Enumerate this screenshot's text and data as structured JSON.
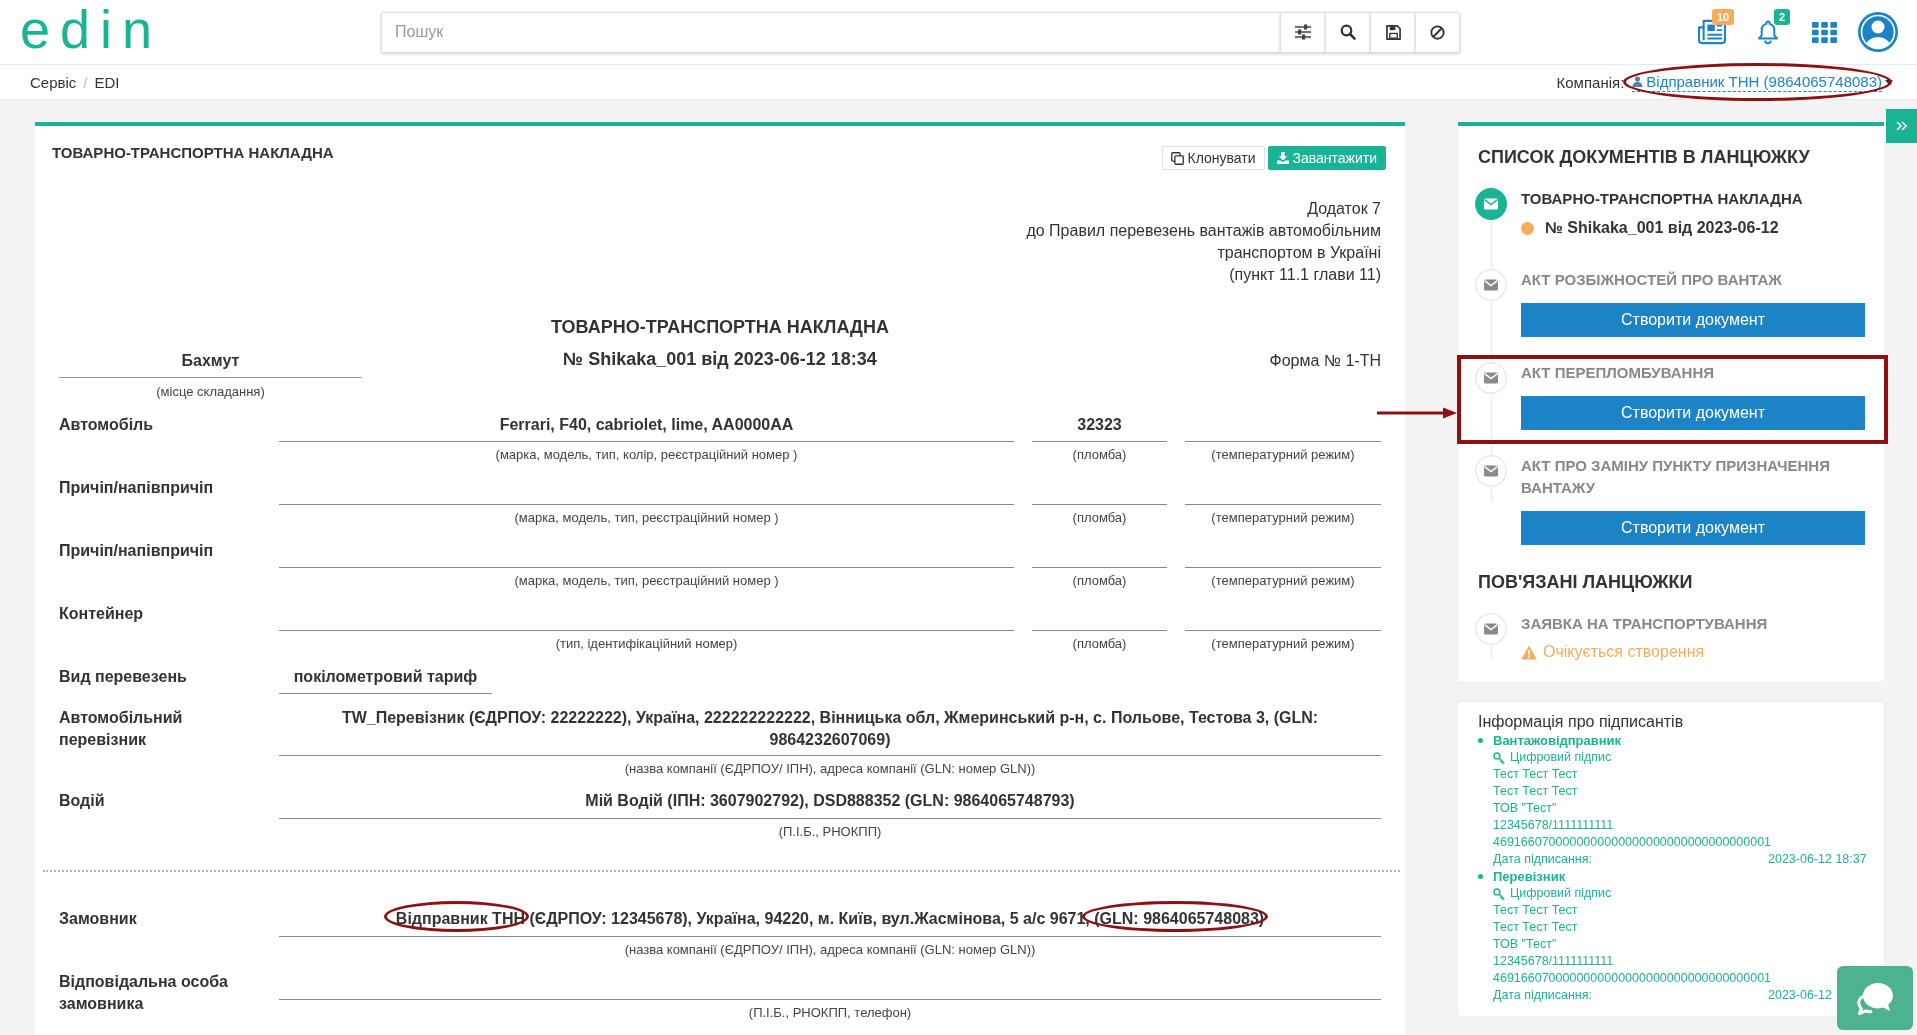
{
  "header": {
    "logo": "edin",
    "search": {
      "placeholder": "Пошук"
    },
    "notifications": [
      {
        "kind": "news",
        "badge": "10",
        "color": "#f8ac59"
      },
      {
        "kind": "bell",
        "badge": "2",
        "color": "#1ab394"
      }
    ]
  },
  "breadcrumbs": {
    "separator": "/",
    "items": [
      {
        "label": "Сервіс"
      },
      {
        "label": "EDI"
      }
    ]
  },
  "company": {
    "label": "Компанія:",
    "value": "Відправник ТНН (9864065748083)",
    "circled": true
  },
  "document": {
    "title": "ТОВАРНО-ТРАНСПОРТНА НАКЛАДНА",
    "actions": [
      {
        "kind": "clone",
        "label": "Клонувати"
      },
      {
        "kind": "download",
        "label": "Завантажити"
      }
    ],
    "appendix_note": [
      "Додаток 7",
      "до Правил перевезень вантажів автомобільним",
      "транспортом в Україні",
      "(пункт 11.1 глави 11)"
    ],
    "heading": [
      "ТОВАРНО-ТРАНСПОРТНА НАКЛАДНА",
      "№ Shikaka_001 від 2023-06-12 18:34"
    ],
    "place": {
      "value": "Бахмут",
      "caption": "(місце складання)"
    },
    "form_number": "Форма № 1-ТН",
    "sections": [
      {
        "rows": [
          {
            "kind": "triple",
            "label": "Автомобіль",
            "fields": [
              {
                "value": "Ferrari, F40, cabriolet, lime, AA0000AA",
                "caption": "(марка, модель, тип, колір, реєстраційний номер )"
              },
              {
                "value": "32323",
                "caption": "(пломба)"
              },
              {
                "caption": "(температурний режим)"
              }
            ]
          },
          {
            "kind": "triple",
            "label": "Причіп/напівпричіп",
            "fields": [
              {
                "caption": "(марка, модель, тип, реєстраційний номер )"
              },
              {
                "caption": "(пломба)"
              },
              {
                "caption": "(температурний режим)"
              }
            ]
          },
          {
            "kind": "triple",
            "label": "Причіп/напівпричіп",
            "fields": [
              {
                "caption": "(марка, модель, тип, реєстраційний номер )"
              },
              {
                "caption": "(пломба)"
              },
              {
                "caption": "(температурний режим)"
              }
            ]
          },
          {
            "kind": "triple",
            "label": "Контейнер",
            "fields": [
              {
                "caption": "(тип, ідентифікаційний номер)"
              },
              {
                "caption": "(пломба)"
              },
              {
                "caption": "(температурний режим)"
              }
            ]
          },
          {
            "kind": "short",
            "label": "Вид перевезень",
            "fields": [
              {
                "value": "покілометровий тариф"
              }
            ]
          },
          {
            "kind": "wide",
            "label": "Автомобільний перевізник",
            "fields": [
              {
                "value": "TW_Перевізник (ЄДРПОУ: 22222222), Україна, 222222222222, Вінницька обл, Жмеринський р-н, с. Польове, Тестова 3, (GLN: 9864232607069)",
                "caption": "(назва компанії (ЄДРПОУ/ ІПН), адреса компанії (GLN: номер GLN))"
              }
            ]
          },
          {
            "kind": "wide",
            "label": "Водій",
            "fields": [
              {
                "value": "Мій Водій (ІПН: 3607902792), DSD888352 (GLN: 9864065748793)",
                "caption": "(П.І.Б., РНОКПП)"
              }
            ]
          }
        ]
      },
      {
        "rows": [
          {
            "kind": "wide",
            "label": "Замовник",
            "fields": [
              {
                "value_parts": [
                  {
                    "text": "Відправник ТНН",
                    "circled": true
                  },
                  {
                    "text": " (ЄДРПОУ: 12345678), Україна, 94220, м. Київ, вул.Жасмінова, 5 а/с 9671, ",
                    "circled": false
                  },
                  {
                    "text": "(GLN: 9864065748083)",
                    "circled": true
                  }
                ],
                "caption": "(назва компанії (ЄДРПОУ/ ІПН), адреса компанії (GLN: номер GLN))"
              }
            ]
          },
          {
            "kind": "wide",
            "label": "Відповідальна особа замовника",
            "fields": [
              {
                "caption": "(П.І.Б., РНОКПП, телефон)"
              }
            ]
          }
        ]
      }
    ]
  },
  "chain_panel": {
    "title": "СПИСОК ДОКУМЕНТІВ В ЛАНЦЮЖКУ",
    "items": [
      {
        "kind": "document",
        "title": "ТОВАРНО-ТРАНСПОРТНА НАКЛАДНА",
        "active": true,
        "color": "#f8ac59",
        "number": "№ Shikaka_001 від 2023-06-12",
        "highlighted": false
      },
      {
        "kind": "create",
        "title": "АКТ РОЗБІЖНОСТЕЙ ПРО ВАНТАЖ",
        "active": false,
        "button": "Створити документ",
        "highlighted": false
      },
      {
        "kind": "create",
        "title": "АКТ ПЕРЕПЛОМБУВАННЯ",
        "active": false,
        "button": "Створити документ",
        "highlighted": true
      },
      {
        "kind": "create",
        "title": "АКТ ПРО ЗАМІНУ ПУНКТУ ПРИЗНАЧЕННЯ ВАНТАЖУ",
        "active": false,
        "button": "Створити документ",
        "highlighted": false
      }
    ],
    "related_title": "ПОВ'ЯЗАНІ ЛАНЦЮЖКИ",
    "related_items": [
      {
        "kind": "pending",
        "title": "ЗАЯВКА НА ТРАНСПОРТУВАННЯ",
        "active": false,
        "status": "Очікується створення",
        "highlighted": false
      }
    ]
  },
  "signers": {
    "title": "Інформація про підписантів",
    "entries": [
      {
        "role": "Вантажовідправник",
        "signature": "Цифровий підпис",
        "details": [
          "Тест Тест Тест",
          "Тест Тест Тест",
          "ТОВ \"Тест\"",
          "12345678/1111111111",
          "4691660700000000000000000000000000000001"
        ],
        "date_label": "Дата підписання:",
        "date": "2023-06-12 18:37"
      },
      {
        "role": "Перевізник",
        "signature": "Цифровий підпис",
        "details": [
          "Тест Тест Тест",
          "Тест Тест Тест",
          "ТОВ \"Тест\"",
          "12345678/1111111111",
          "4691660700000000000000000000000000000001"
        ],
        "date_label": "Дата підписання:",
        "date": "2023-06-12"
      }
    ]
  }
}
